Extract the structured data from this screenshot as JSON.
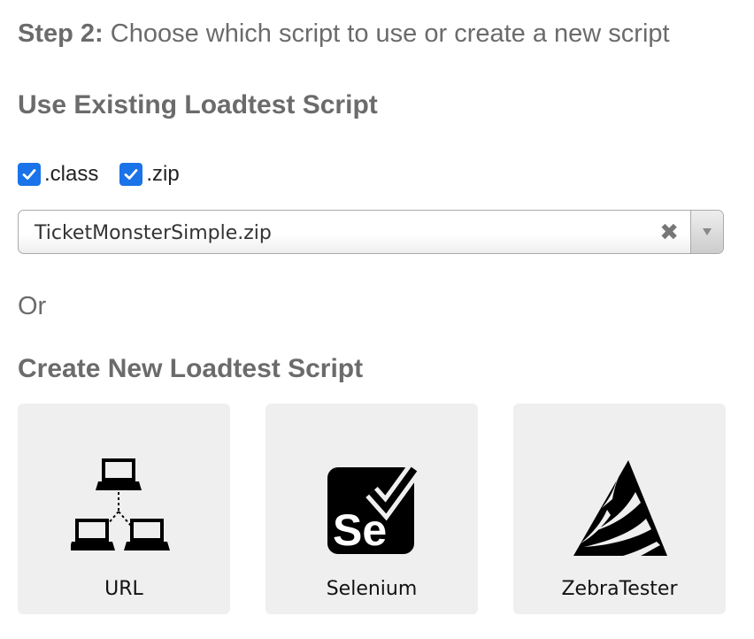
{
  "step": {
    "prefix": "Step 2:",
    "text": " Choose which script to use or create a new script"
  },
  "existing": {
    "heading": "Use Existing Loadtest Script",
    "filters": [
      {
        "label": ".class",
        "checked": true
      },
      {
        "label": ".zip",
        "checked": true
      }
    ],
    "select": {
      "value": "TicketMonsterSimple.zip",
      "clear_glyph": "✖"
    }
  },
  "or_text": "Or",
  "create": {
    "heading": "Create New Loadtest Script",
    "options": [
      {
        "label": "URL",
        "icon": "network-computers-icon"
      },
      {
        "label": "Selenium",
        "icon": "selenium-icon",
        "icon_text": "Se"
      },
      {
        "label": "ZebraTester",
        "icon": "zebratester-icon"
      }
    ]
  },
  "colors": {
    "checkbox": "#1a73e8",
    "card_bg": "#efefef",
    "heading_text": "#6b6b6b"
  }
}
